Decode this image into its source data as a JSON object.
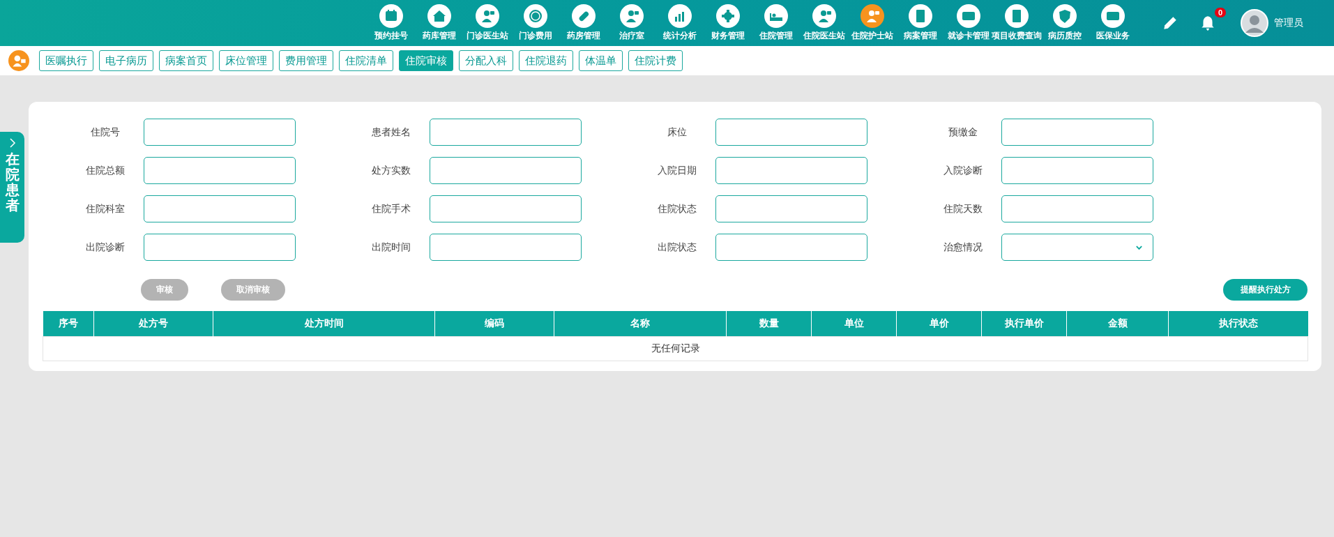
{
  "nav": [
    {
      "label": "预约挂号",
      "selected": false
    },
    {
      "label": "药库管理",
      "selected": false
    },
    {
      "label": "门诊医生站",
      "selected": false
    },
    {
      "label": "门诊费用",
      "selected": false
    },
    {
      "label": "药房管理",
      "selected": false
    },
    {
      "label": "治疗室",
      "selected": false
    },
    {
      "label": "统计分析",
      "selected": false
    },
    {
      "label": "财务管理",
      "selected": false
    },
    {
      "label": "住院管理",
      "selected": false
    },
    {
      "label": "住院医生站",
      "selected": false
    },
    {
      "label": "住院护士站",
      "selected": true
    },
    {
      "label": "病案管理",
      "selected": false
    },
    {
      "label": "就诊卡管理",
      "selected": false
    },
    {
      "label": "项目收费查询",
      "selected": false
    },
    {
      "label": "病历质控",
      "selected": false
    },
    {
      "label": "医保业务",
      "selected": false
    }
  ],
  "notifications": {
    "count": "0"
  },
  "user": {
    "name": "管理员"
  },
  "tabs": [
    {
      "label": "医嘱执行",
      "selected": false
    },
    {
      "label": "电子病历",
      "selected": false
    },
    {
      "label": "病案首页",
      "selected": false
    },
    {
      "label": "床位管理",
      "selected": false
    },
    {
      "label": "费用管理",
      "selected": false
    },
    {
      "label": "住院清单",
      "selected": false
    },
    {
      "label": "住院审核",
      "selected": true
    },
    {
      "label": "分配入科",
      "selected": false
    },
    {
      "label": "住院退药",
      "selected": false
    },
    {
      "label": "体温单",
      "selected": false
    },
    {
      "label": "住院计费",
      "selected": false
    }
  ],
  "side_tab": {
    "label": "在院患者"
  },
  "form": {
    "fields": [
      {
        "label": "住院号",
        "kind": "text"
      },
      {
        "label": "患者姓名",
        "kind": "text"
      },
      {
        "label": "床位",
        "kind": "text"
      },
      {
        "label": "预缴金",
        "kind": "text"
      },
      {
        "label": "住院总额",
        "kind": "text"
      },
      {
        "label": "处方实数",
        "kind": "text"
      },
      {
        "label": "入院日期",
        "kind": "text"
      },
      {
        "label": "入院诊断",
        "kind": "text"
      },
      {
        "label": "住院科室",
        "kind": "text"
      },
      {
        "label": "住院手术",
        "kind": "text"
      },
      {
        "label": "住院状态",
        "kind": "text"
      },
      {
        "label": "住院天数",
        "kind": "text"
      },
      {
        "label": "出院诊断",
        "kind": "text"
      },
      {
        "label": "出院时间",
        "kind": "text"
      },
      {
        "label": "出院状态",
        "kind": "text"
      },
      {
        "label": "治愈情况",
        "kind": "select"
      }
    ]
  },
  "actions": [
    {
      "label": "审核",
      "disabled": true
    },
    {
      "label": "取消审核",
      "disabled": true
    }
  ],
  "remind_button": {
    "label": "提醒执行处方"
  },
  "table": {
    "columns": [
      "序号",
      "处方号",
      "处方时间",
      "编码",
      "名称",
      "数量",
      "单位",
      "单价",
      "执行单价",
      "金额",
      "执行状态"
    ],
    "empty_message": "无任何记录"
  }
}
